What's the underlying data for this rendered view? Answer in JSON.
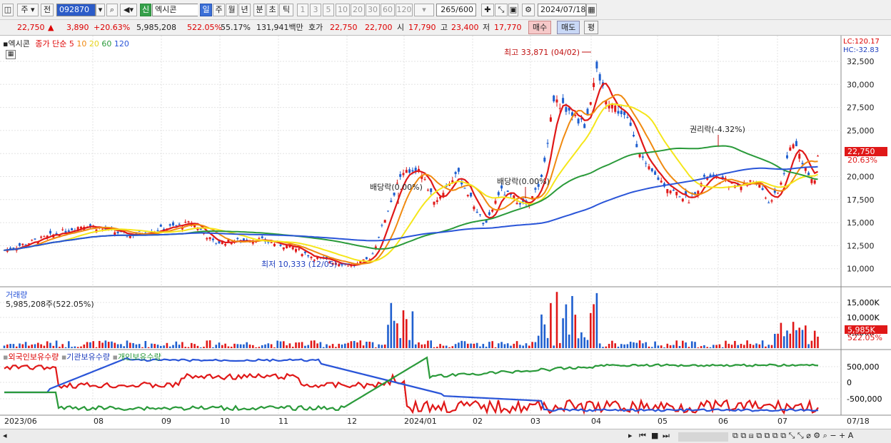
{
  "toolbar": {
    "market": "주",
    "prev": "전",
    "code": "092870",
    "stock_name_tag": "신",
    "stock_name": "엑시콘",
    "periods": [
      "일",
      "주",
      "월",
      "년",
      "분",
      "초",
      "틱"
    ],
    "active_period": "일",
    "intervals": [
      "1",
      "3",
      "5",
      "10",
      "20",
      "30",
      "60",
      "120"
    ],
    "count": "265/600",
    "date": "2024/07/18"
  },
  "quote": {
    "price": "22,750",
    "arrow": "▲",
    "change": "3,890",
    "change_pct": "+20.63%",
    "volume": "5,985,208",
    "vol_ratio": "522.05%",
    "turnover": "55.17%",
    "amount": "131,941백만",
    "bid_label": "호가",
    "ask": "22,750",
    "bid": "22,700",
    "open_label": "시",
    "open": "17,790",
    "high_label": "고",
    "high": "23,400",
    "low_label": "저",
    "low": "17,770",
    "buy_btn": "매수",
    "sell_btn": "매도",
    "eval_btn": "평"
  },
  "price_pane": {
    "legend_name": "엑시콘",
    "legend_ma": "종가 단순",
    "ma_periods": [
      "5",
      "10",
      "20",
      "60",
      "120"
    ],
    "lc": "LC:120.17",
    "hc": "HC:-32.83",
    "high_note": "최고 33,871 (04/02)",
    "low_note": "최저 10,333 (12/05)",
    "div1": "배당락(0.00%)",
    "div2": "배당락(0.00%)",
    "rights": "권리락(-4.32%)",
    "cur_price": "22,750",
    "cur_pct": "20.63%",
    "y_ticks": [
      "32,500",
      "30,000",
      "27,500",
      "25,000",
      "22,500",
      "20,000",
      "17,500",
      "15,000",
      "12,500",
      "10,000"
    ]
  },
  "volume_pane": {
    "title": "거래량",
    "value": "5,985,208주(522.05%)",
    "y_ticks": [
      "15,000K",
      "10,000K",
      "5,000K"
    ],
    "cur": "5,985K",
    "cur_pct": "522.05%"
  },
  "holding_pane": {
    "s1": "외국인보유수량",
    "s2": "기관보유수량",
    "s3": "개인보유수량",
    "y_ticks": [
      "500,000",
      "0",
      "-500,000"
    ]
  },
  "x_labels": [
    "2023/06",
    "08",
    "09",
    "10",
    "11",
    "12",
    "2024/01",
    "02",
    "03",
    "04",
    "05",
    "06",
    "07",
    "07/18"
  ],
  "colors": {
    "ma5": "#e01818",
    "ma10": "#f08a10",
    "ma20": "#f5e61a",
    "ma60": "#2a9a3a",
    "ma120": "#2a55d8",
    "up": "#e01818",
    "down": "#1f5fcf"
  }
}
